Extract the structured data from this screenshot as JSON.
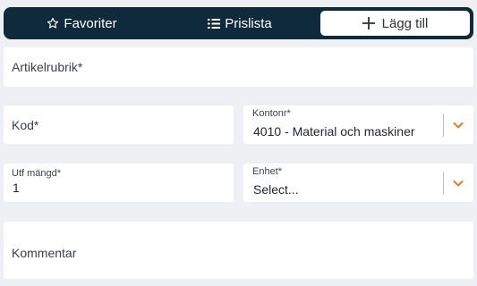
{
  "tabs": {
    "favorites_label": "Favoriter",
    "pricelist_label": "Prislista",
    "add_label": "Lägg till"
  },
  "form": {
    "title_placeholder": "Artikelrubrik*",
    "code_placeholder": "Kod*",
    "account": {
      "label": "Kontonr*",
      "value": "4010 - Material och maskiner"
    },
    "quantity": {
      "label": "Utf mängd*",
      "value": "1"
    },
    "unit": {
      "label": "Enhet*",
      "value": "Select..."
    },
    "comment_placeholder": "Kommentar"
  },
  "colors": {
    "tabbar_bg": "#0f2a3a",
    "accent_chevron": "#e07a2e",
    "page_bg": "#eef0f3"
  },
  "icons": {
    "favorites": "star-icon",
    "pricelist": "list-icon",
    "add": "plus-icon",
    "dropdown": "chevron-down-icon"
  }
}
